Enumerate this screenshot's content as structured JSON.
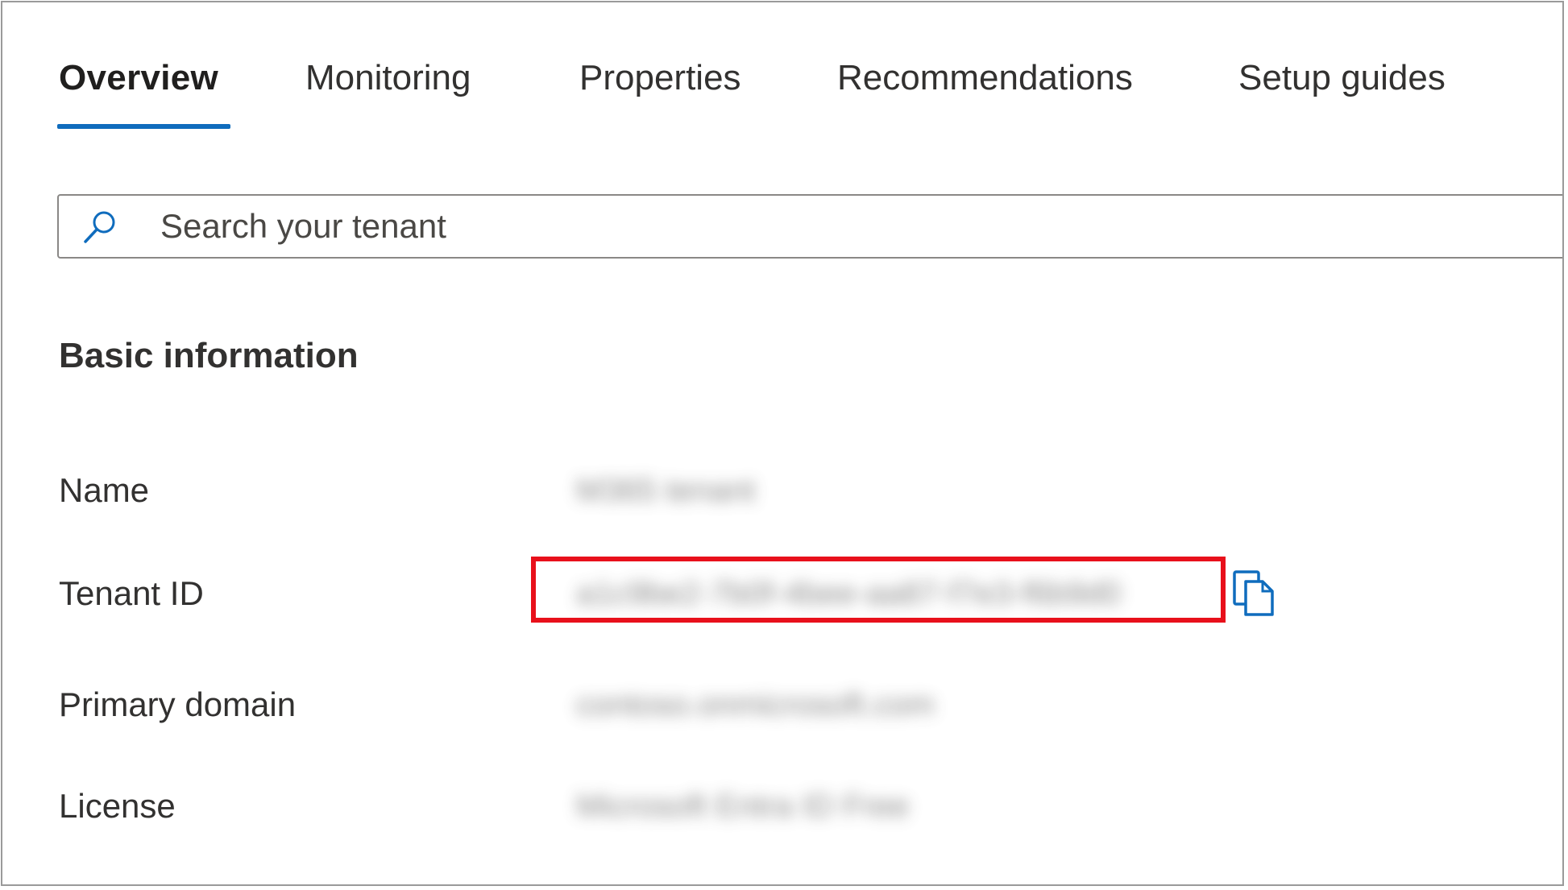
{
  "tabs": [
    {
      "label": "Overview",
      "active": true
    },
    {
      "label": "Monitoring",
      "active": false
    },
    {
      "label": "Properties",
      "active": false
    },
    {
      "label": "Recommendations",
      "active": false
    },
    {
      "label": "Setup guides",
      "active": false
    }
  ],
  "search": {
    "placeholder": "Search your tenant",
    "value": "",
    "icon": "search-icon"
  },
  "basic_info": {
    "title": "Basic information",
    "rows": [
      {
        "label": "Name",
        "value": "M365 tenant"
      },
      {
        "label": "Tenant ID",
        "value": "a1c9be2-7b0f-4bee-aa87-f7e3-f6b9d0"
      },
      {
        "label": "Primary domain",
        "value": "contoso.onmicrosoft.com"
      },
      {
        "label": "License",
        "value": "Microsoft Entra ID Free"
      }
    ],
    "copy_icon": "copy-icon"
  },
  "colors": {
    "accent": "#0f6cbd",
    "highlight": "#e8101b",
    "text": "#323130"
  }
}
